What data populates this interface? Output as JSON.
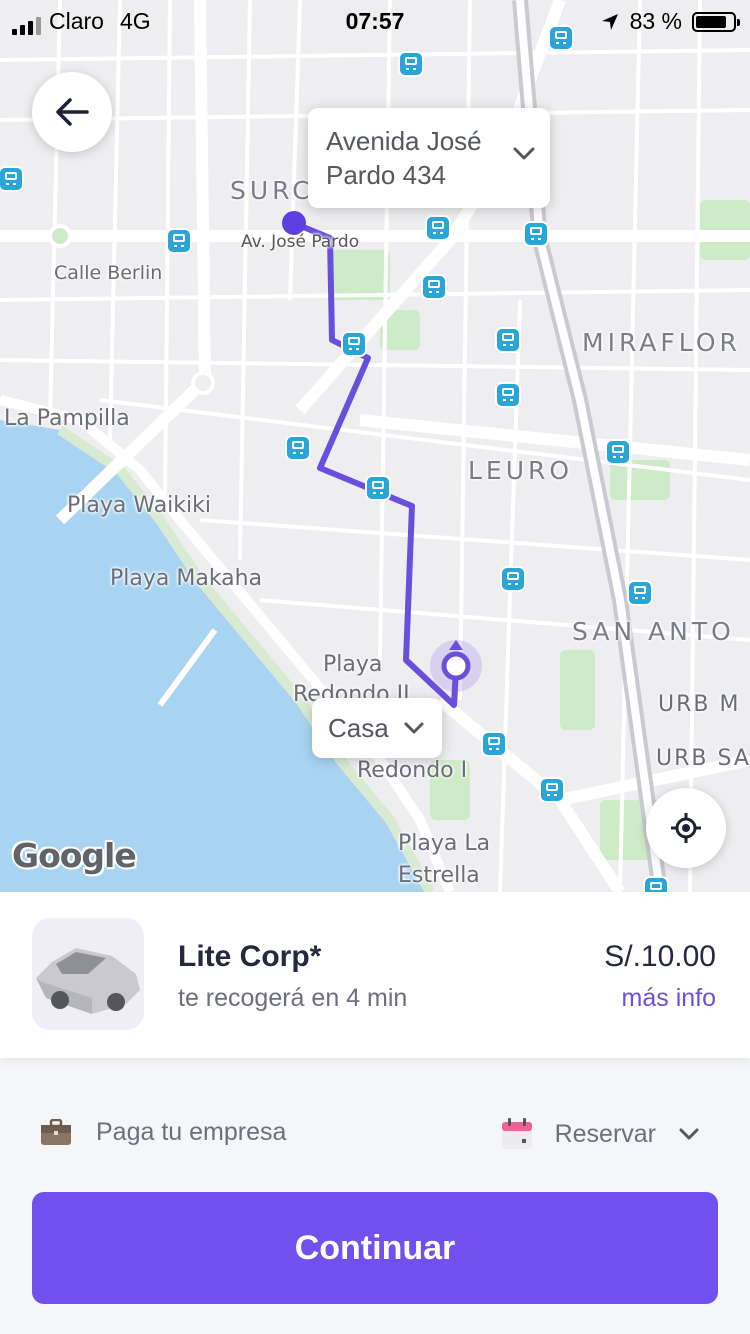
{
  "status_bar": {
    "carrier": "Claro",
    "network": "4G",
    "time": "07:57",
    "battery": "83 %",
    "battery_level": 0.83
  },
  "map": {
    "labels": {
      "surco": "SURCO",
      "av_jose_pardo": "Av. José Pardo",
      "calle_berlin": "Calle Berlin",
      "miraflores": "MIRAFLOR",
      "la_pampilla": "La Pampilla",
      "playa_waikiki": "Playa Waikiki",
      "leuro": "LEURO",
      "playa_makaha": "Playa Makaha",
      "san_antonio": "SAN ANTO",
      "playa_redondo": "Playa",
      "redondo_ii": "Redondo II",
      "urb_m": "URB M",
      "redondo_i": "Redondo I",
      "urb_sa": "URB SA",
      "playa_la_estrella": "Playa La Estrella",
      "brand": "Google"
    },
    "pickup_address": "Avenida José Pardo 434",
    "destination_label": "Casa",
    "colors": {
      "route": "#6a4fdc",
      "water": "#a8d4f2",
      "park": "#cdebc7",
      "bus_stop": "#2aa5d8"
    }
  },
  "ride": {
    "name": "Lite Corp*",
    "eta": "te recogerá en 4 min",
    "price": "S/.10.00",
    "more_info": "más info"
  },
  "options": {
    "payment": "Paga tu empresa",
    "schedule": "Reservar"
  },
  "cta": {
    "label": "Continuar",
    "color": "#7150ee"
  }
}
